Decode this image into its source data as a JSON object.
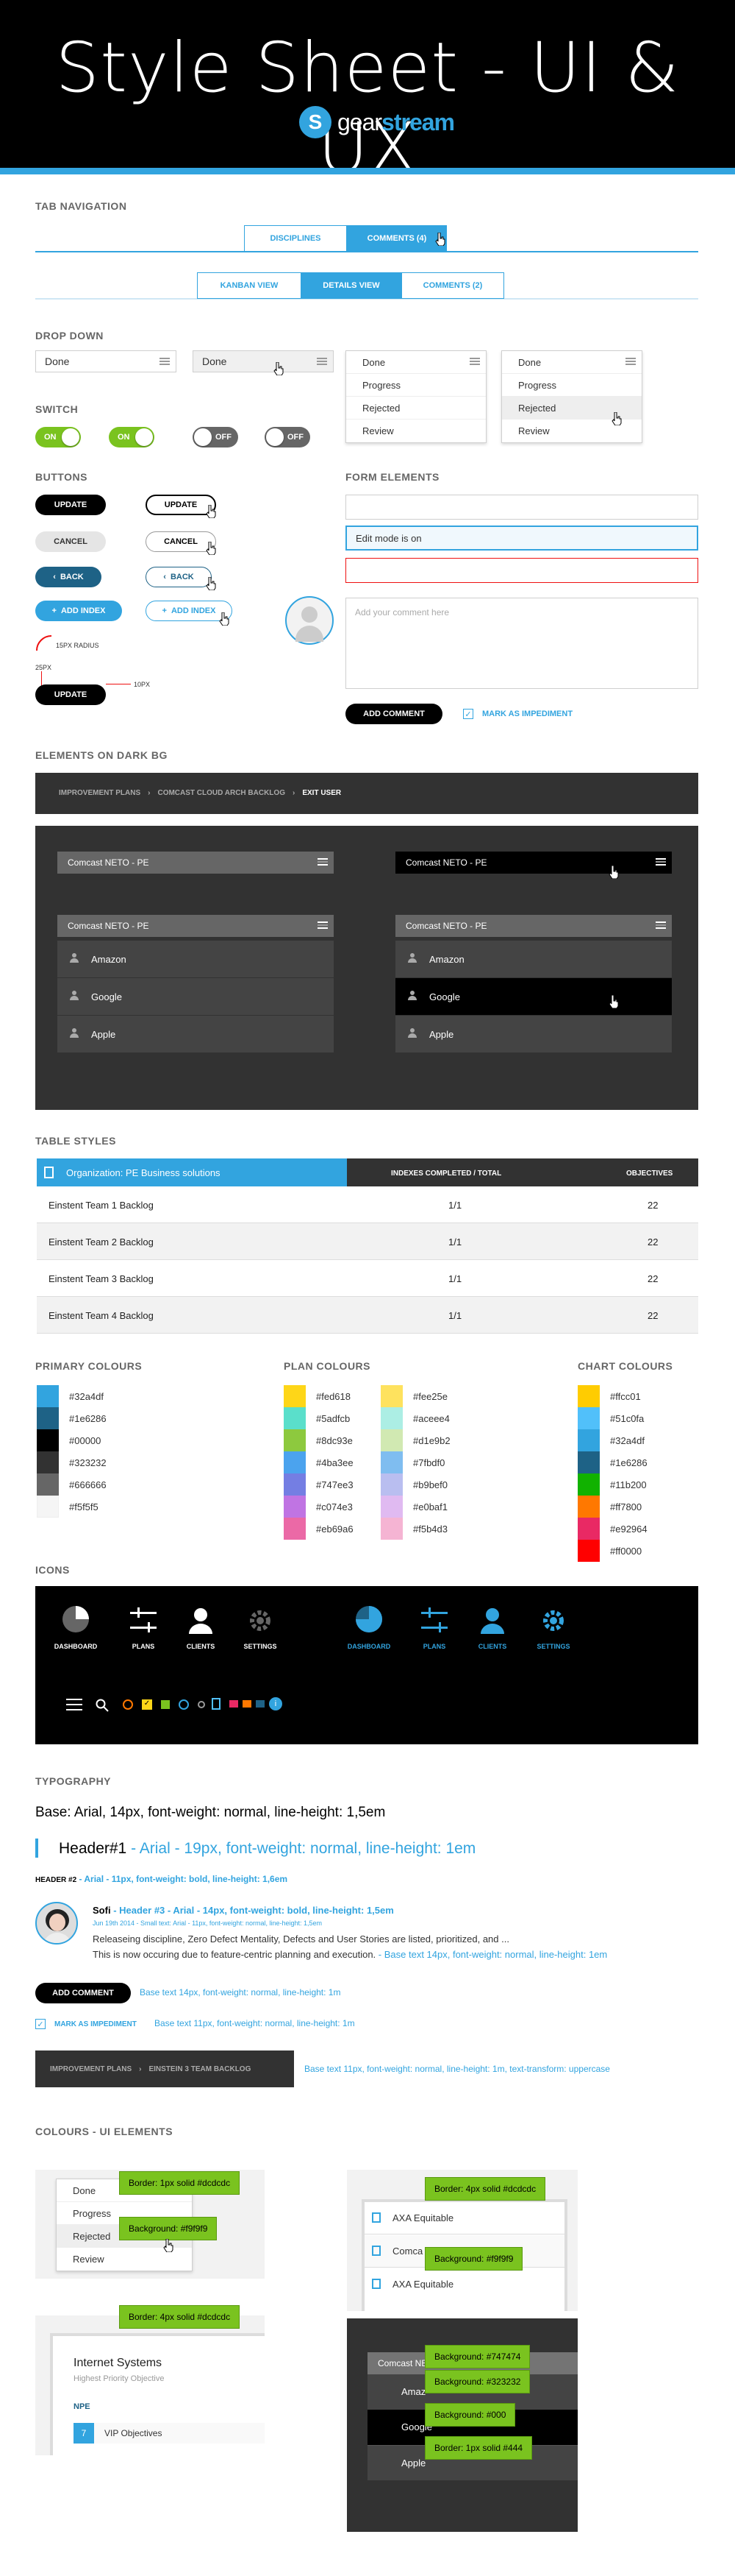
{
  "header": {
    "title": "Style Sheet - UI & UX",
    "logo_prefix": "gear",
    "logo_suffix": "stream"
  },
  "colors": {
    "primary": "#32a4df",
    "accent_green": "#7ac31f",
    "dark": "#323232"
  },
  "tabs": {
    "section": "TAB NAVIGATION",
    "row1": [
      "DISCIPLINES",
      "COMMENTS (4)"
    ],
    "row2": [
      "KANBAN VIEW",
      "DETAILS VIEW",
      "COMMENTS (2)"
    ]
  },
  "dropdown": {
    "section": "DROP DOWN",
    "value": "Done",
    "options": [
      "Done",
      "Progress",
      "Rejected",
      "Review"
    ]
  },
  "switch": {
    "section": "SWITCH",
    "on": "ON",
    "off": "OFF"
  },
  "buttons": {
    "section": "BUTTONS",
    "update": "UPDATE",
    "cancel": "CANCEL",
    "back": "BACK",
    "add_index": "ADD INDEX",
    "radius_note": "15PX RADIUS",
    "px25": "25PX",
    "px10": "10PX"
  },
  "form": {
    "section": "FORM ELEMENTS",
    "edit_mode": "Edit mode is on",
    "comment_placeholder": "Add your comment here",
    "add_comment": "ADD COMMENT",
    "mark_impediment": "MARK AS IMPEDIMENT"
  },
  "dark": {
    "section": "ELEMENTS ON DARK BG",
    "breadcrumb": [
      "IMPROVEMENT PLANS",
      "COMCAST CLOUD ARCH BACKLOG",
      "EXIT USER"
    ],
    "menu_title": "Comcast NETO - PE",
    "items": [
      "Amazon",
      "Google",
      "Apple"
    ]
  },
  "table": {
    "section": "TABLE STYLES",
    "org": "Organization: PE Business solutions",
    "col2": "INDEXES COMPLETED / TOTAL",
    "col3": "OBJECTIVES",
    "rows": [
      {
        "name": "Einstent Team 1 Backlog",
        "idx": "1/1",
        "obj": "22"
      },
      {
        "name": "Einstent Team 2 Backlog",
        "idx": "1/1",
        "obj": "22"
      },
      {
        "name": "Einstent Team 3 Backlog",
        "idx": "1/1",
        "obj": "22"
      },
      {
        "name": "Einstent Team 4 Backlog",
        "idx": "1/1",
        "obj": "22"
      }
    ]
  },
  "palettes": {
    "primary_title": "PRIMARY COLOURS",
    "primary": [
      "#32a4df",
      "#1e6286",
      "#00000",
      "#323232",
      "#666666",
      "#f5f5f5"
    ],
    "plan_title": "PLAN COLOURS",
    "plan_a": [
      "#fed618",
      "#5adfcb",
      "#8dc93e",
      "#4ba3ee",
      "#747ee3",
      "#c074e3",
      "#eb69a6"
    ],
    "plan_b": [
      "#fee25e",
      "#aceee4",
      "#d1e9b2",
      "#7fbdf0",
      "#b9bef0",
      "#e0baf1",
      "#f5b4d3"
    ],
    "chart_title": "CHART COLOURS",
    "chart": [
      "#ffcc01",
      "#51c0fa",
      "#32a4df",
      "#1e6286",
      "#11b200",
      "#ff7800",
      "#e92964",
      "#ff0000"
    ]
  },
  "icons": {
    "section": "ICONS",
    "labels": [
      "DASHBOARD",
      "PLANS",
      "CLIENTS",
      "SETTINGS"
    ]
  },
  "typography": {
    "section": "TYPOGRAPHY",
    "base": "Base: Arial, 14px, font-weight: normal, line-height: 1,5em",
    "h1": "Header#1",
    "h1_spec": "- Arial - 19px, font-weight: normal, line-height: 1em",
    "h2": "HEADER #2",
    "h2_spec": "- Arial - 11px, font-weight: bold, line-height: 1,6em",
    "h3_name": "Sofi",
    "h3_spec": "- Header #3 - Arial - 14px, font-weight: bold, line-height: 1,5em",
    "small_meta": "Jun 19th 2014 - Small text: Arial - 11px, font-weight: normal, line-height: 1,5em",
    "body1": "Releaseing discipline, Zero Defect Mentality, Defects and User Stories are listed, prioritized, and ...",
    "body2": "This is now occuring due to feature-centric planning and execution.",
    "body2_spec": "- Base text 14px, font-weight: normal, line-height: 1em",
    "btn_spec": "Base text 14px, font-weight: normal, line-height: 1m",
    "mark_spec": "Base text 11px, font-weight: normal, line-height: 1m",
    "bc": [
      "IMPROVEMENT PLANS",
      "EINSTEIN 3 TEAM BACKLOG"
    ],
    "bc_spec": "Base text 11px, font-weight: normal, line-height: 1m, text-transform: uppercase"
  },
  "ui_colours": {
    "section": "COLOURS - UI ELEMENTS",
    "border_dcdcdc": "Border: 1px solid #dcdcdc",
    "bg_f9f9f9": "Background: #f9f9f9",
    "border4": "Border: 4px solid #dcdcdc",
    "axa": "AXA Equitable",
    "axa2": "Comca",
    "axa3": "AXA Equitable",
    "bg_747474": "Background: #747474",
    "bg_323232": "Background: #323232",
    "bg_000": "Background: #000",
    "border_444": "Border: 1px solid #444",
    "card_title": "Internet Systems",
    "card_sub": "Highest Priority Objective",
    "card_npe": "NPE",
    "card_num": "7",
    "card_vip": "VIP Objectives",
    "dk_title": "Comcast NE",
    "dk_items": [
      "Amaz",
      "Google",
      "Apple"
    ]
  }
}
